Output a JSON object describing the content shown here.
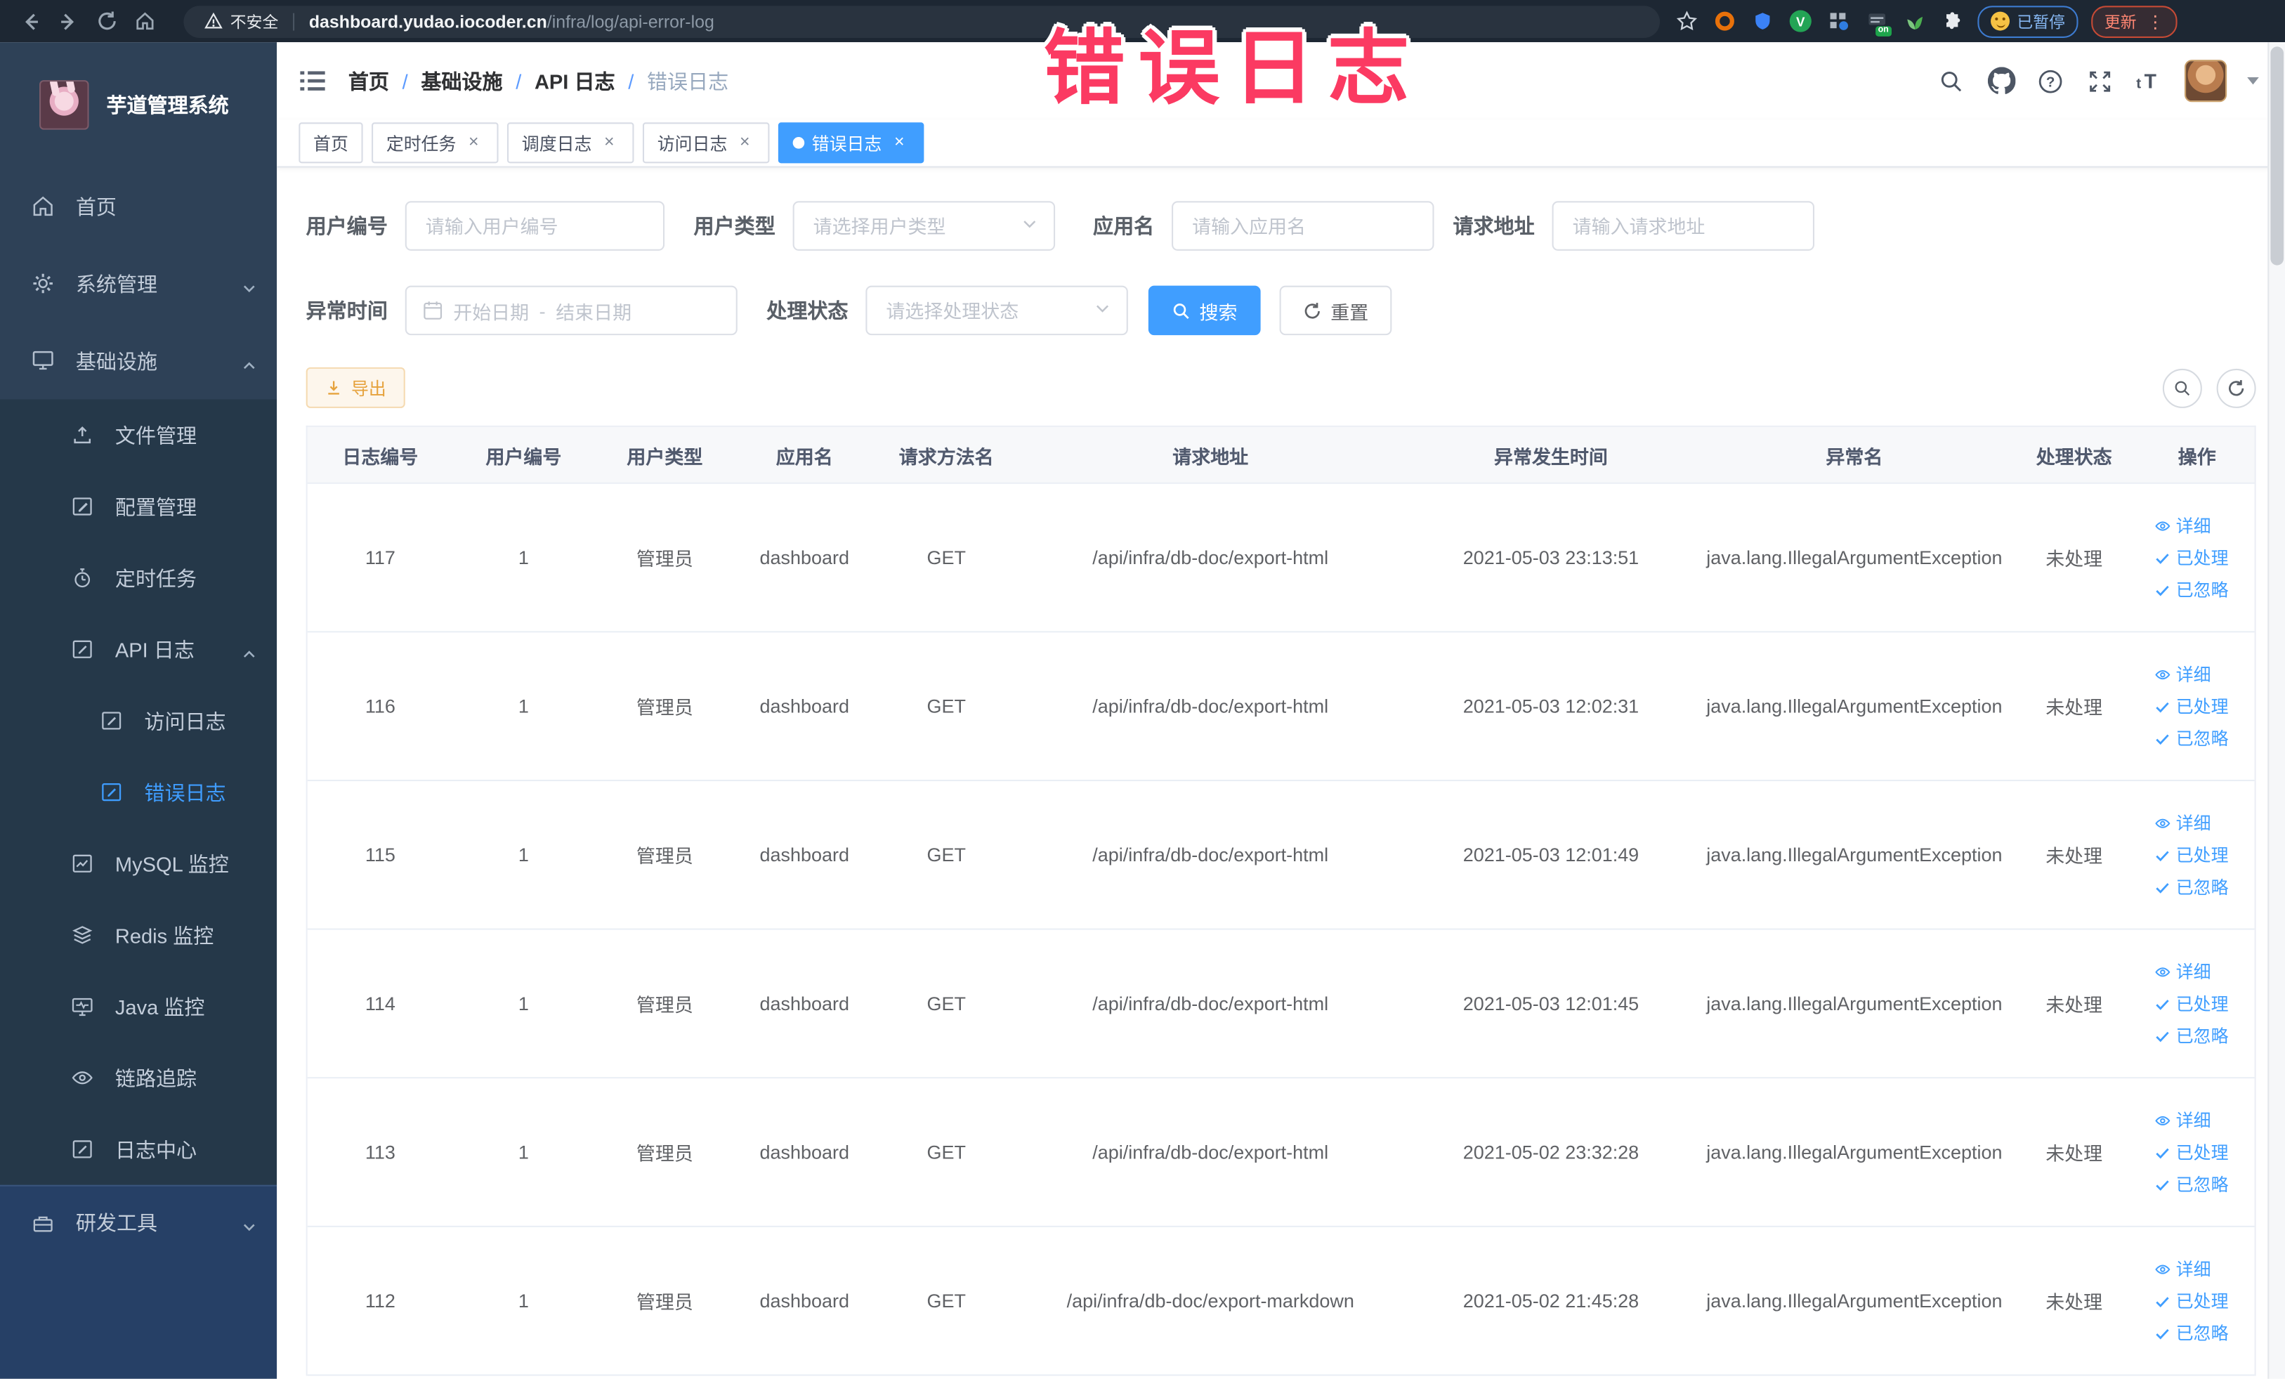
{
  "browser": {
    "security_label": "不安全",
    "url_host": "dashboard.yudao.iocoder.cn",
    "url_path": "/infra/log/api-error-log",
    "on_badge": "on",
    "paused_badge": "已暂停",
    "update_button": "更新"
  },
  "annotation": {
    "text": "错误日志",
    "color": "#fb3a62"
  },
  "sidebar": {
    "title": "芋道管理系统",
    "items": [
      {
        "label": "首页"
      },
      {
        "label": "系统管理"
      },
      {
        "label": "基础设施"
      },
      {
        "label": "文件管理"
      },
      {
        "label": "配置管理"
      },
      {
        "label": "定时任务"
      },
      {
        "label": "API 日志"
      },
      {
        "label": "访问日志"
      },
      {
        "label": "错误日志"
      },
      {
        "label": "MySQL 监控"
      },
      {
        "label": "Redis 监控"
      },
      {
        "label": "Java 监控"
      },
      {
        "label": "链路追踪"
      },
      {
        "label": "日志中心"
      },
      {
        "label": "研发工具"
      }
    ]
  },
  "breadcrumb": {
    "separator": "/",
    "items": [
      {
        "label": "首页"
      },
      {
        "label": "基础设施"
      },
      {
        "label": "API 日志"
      },
      {
        "label": "错误日志"
      }
    ]
  },
  "tags": [
    {
      "label": "首页"
    },
    {
      "label": "定时任务"
    },
    {
      "label": "调度日志"
    },
    {
      "label": "访问日志"
    },
    {
      "label": "错误日志"
    }
  ],
  "filters": {
    "user_id": {
      "label": "用户编号",
      "placeholder": "请输入用户编号"
    },
    "user_type": {
      "label": "用户类型",
      "placeholder": "请选择用户类型"
    },
    "app_name": {
      "label": "应用名",
      "placeholder": "请输入应用名"
    },
    "request_url": {
      "label": "请求地址",
      "placeholder": "请输入请求地址"
    },
    "exception_time": {
      "label": "异常时间",
      "start_placeholder": "开始日期",
      "separator": "-",
      "end_placeholder": "结束日期"
    },
    "process_status": {
      "label": "处理状态",
      "placeholder": "请选择处理状态"
    },
    "search_button": "搜索",
    "reset_button": "重置"
  },
  "toolbar": {
    "export_button": "导出"
  },
  "table": {
    "headers": [
      "日志编号",
      "用户编号",
      "用户类型",
      "应用名",
      "请求方法名",
      "请求地址",
      "异常发生时间",
      "异常名",
      "处理状态",
      "操作"
    ],
    "actions": {
      "detail": "详细",
      "processed": "已处理",
      "ignored": "已忽略"
    },
    "rows": [
      {
        "id": "117",
        "user_id": "1",
        "user_type": "管理员",
        "app": "dashboard",
        "method": "GET",
        "url": "/api/infra/db-doc/export-html",
        "time": "2021-05-03 23:13:51",
        "exception": "java.lang.IllegalArgumentException",
        "status": "未处理"
      },
      {
        "id": "116",
        "user_id": "1",
        "user_type": "管理员",
        "app": "dashboard",
        "method": "GET",
        "url": "/api/infra/db-doc/export-html",
        "time": "2021-05-03 12:02:31",
        "exception": "java.lang.IllegalArgumentException",
        "status": "未处理"
      },
      {
        "id": "115",
        "user_id": "1",
        "user_type": "管理员",
        "app": "dashboard",
        "method": "GET",
        "url": "/api/infra/db-doc/export-html",
        "time": "2021-05-03 12:01:49",
        "exception": "java.lang.IllegalArgumentException",
        "status": "未处理"
      },
      {
        "id": "114",
        "user_id": "1",
        "user_type": "管理员",
        "app": "dashboard",
        "method": "GET",
        "url": "/api/infra/db-doc/export-html",
        "time": "2021-05-03 12:01:45",
        "exception": "java.lang.IllegalArgumentException",
        "status": "未处理"
      },
      {
        "id": "113",
        "user_id": "1",
        "user_type": "管理员",
        "app": "dashboard",
        "method": "GET",
        "url": "/api/infra/db-doc/export-html",
        "time": "2021-05-02 23:32:28",
        "exception": "java.lang.IllegalArgumentException",
        "status": "未处理"
      },
      {
        "id": "112",
        "user_id": "1",
        "user_type": "管理员",
        "app": "dashboard",
        "method": "GET",
        "url": "/api/infra/db-doc/export-markdown",
        "time": "2021-05-02 21:45:28",
        "exception": "java.lang.IllegalArgumentException",
        "status": "未处理"
      }
    ]
  },
  "colors": {
    "accent": "#409eff",
    "annotation_pink": "#fb3a62",
    "warning_orange": "#e6a23c",
    "sidebar_bg": "#2e4157"
  }
}
